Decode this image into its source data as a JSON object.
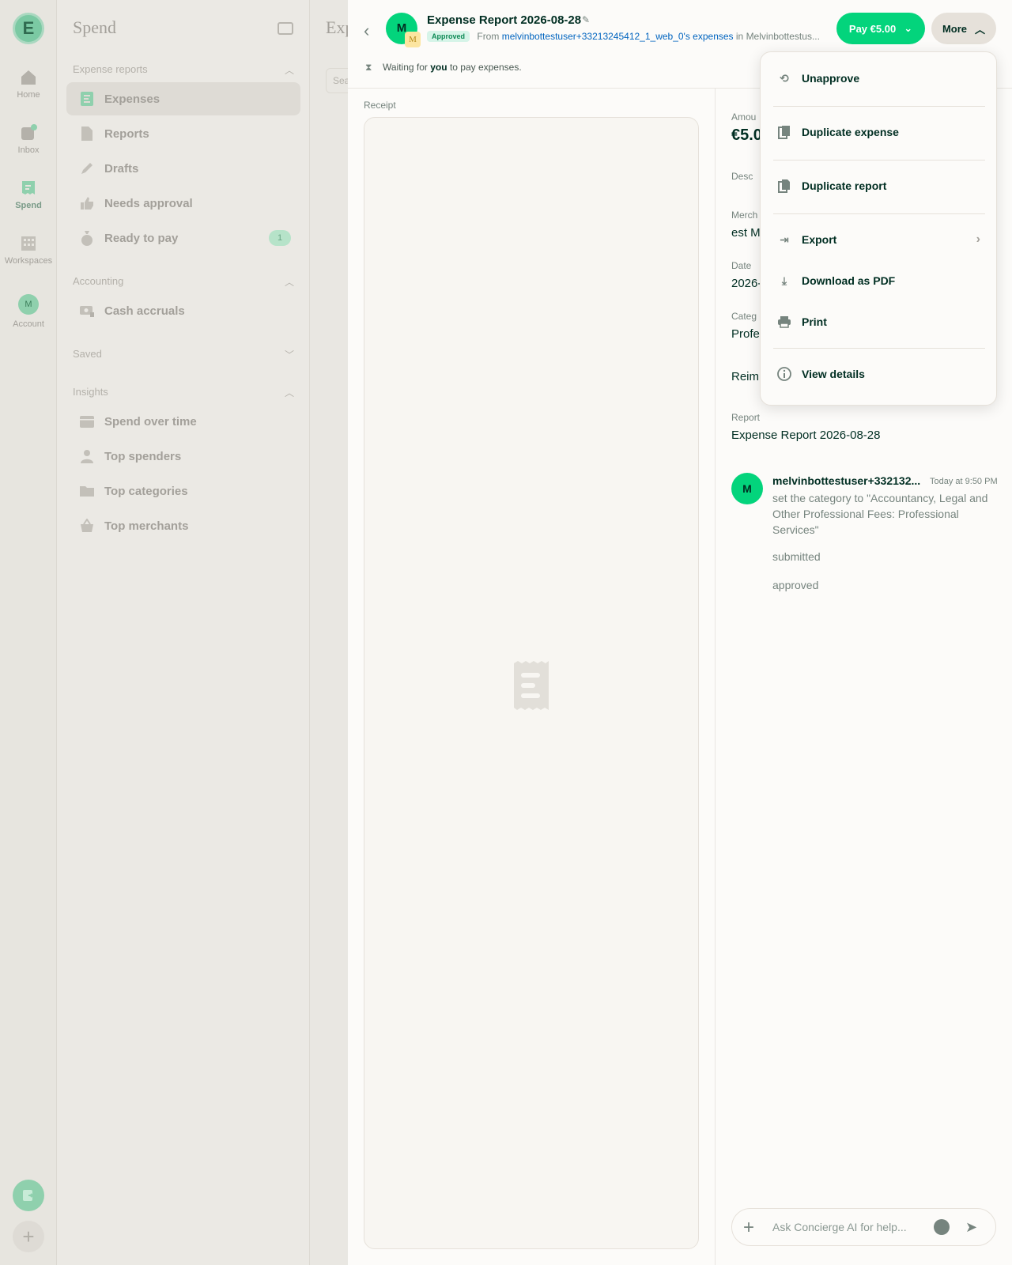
{
  "rail": {
    "logo": "E",
    "items": [
      {
        "label": "Home"
      },
      {
        "label": "Inbox"
      },
      {
        "label": "Spend"
      },
      {
        "label": "Workspaces"
      },
      {
        "label": "Account",
        "avatar": "M"
      }
    ]
  },
  "sidebar": {
    "title": "Spend",
    "sections": {
      "expense_reports": "Expense reports",
      "accounting": "Accounting",
      "saved": "Saved",
      "insights": "Insights"
    },
    "items": {
      "expenses": "Expenses",
      "reports": "Reports",
      "drafts": "Drafts",
      "needs_approval": "Needs approval",
      "ready_to_pay": "Ready to pay",
      "ready_to_pay_badge": "1",
      "cash_accruals": "Cash accruals",
      "spend_over_time": "Spend over time",
      "top_spenders": "Top spenders",
      "top_categories": "Top categories",
      "top_merchants": "Top merchants"
    }
  },
  "middle": {
    "title": "Exp",
    "search": "Sea"
  },
  "header": {
    "avatar": "M",
    "workspace_avatar": "M",
    "title": "Expense Report 2026-08-28",
    "status_pill": "Approved",
    "from_prefix": "From",
    "from_link": "melvinbottestuser+33213245412_1_web_0's expenses",
    "in_text": "in Melvinbottestus...",
    "pay_button": "Pay €5.00",
    "more_button": "More",
    "waiting_pre": "Waiting for",
    "waiting_bold": "you",
    "waiting_post": "to pay expenses."
  },
  "receipt": {
    "label": "Receipt"
  },
  "fields": {
    "amount_label": "Amou",
    "amount_value": "€5.0",
    "description_label": "Desc",
    "merchant_label": "Merch",
    "merchant_value": "est M",
    "date_label": "Date",
    "date_value": "2026-",
    "category_label": "Categ",
    "category_value": "Profe",
    "reimbursable_label": "Reim",
    "report_label": "Report",
    "report_value": "Expense Report 2026-08-28"
  },
  "comment": {
    "avatar": "M",
    "name": "melvinbottestuser+332132...",
    "time": "Today at 9:50 PM",
    "text": "set the category to \"Accountancy, Legal and Other Professional Fees: Professional Services\"",
    "line2": "submitted",
    "line3": "approved"
  },
  "composer": {
    "placeholder": "Ask Concierge AI for help..."
  },
  "menu": {
    "unapprove": "Unapprove",
    "duplicate_expense": "Duplicate expense",
    "duplicate_report": "Duplicate report",
    "export": "Export",
    "download_pdf": "Download as PDF",
    "print": "Print",
    "view_details": "View details"
  },
  "colors": {
    "accent_green": "#03d47c",
    "link_blue": "#0164bf",
    "text_dark": "#002e22"
  }
}
